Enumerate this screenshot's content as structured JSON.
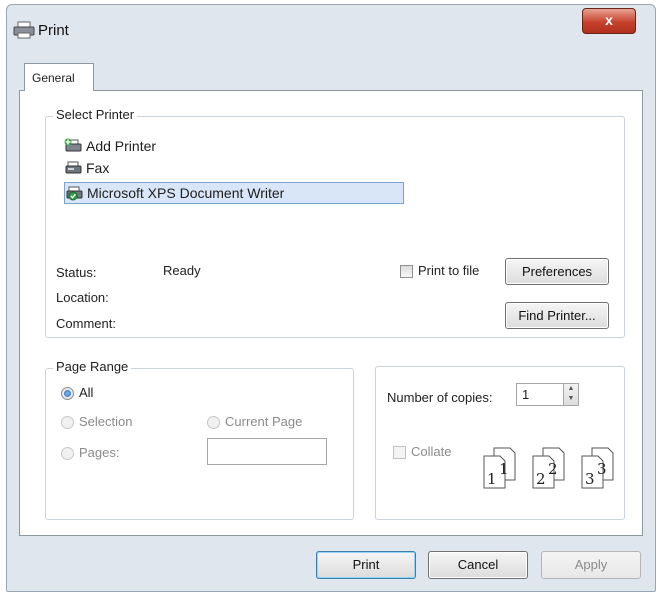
{
  "window": {
    "title": "Print",
    "close_glyph": "x"
  },
  "tabs": [
    {
      "label": "General"
    }
  ],
  "select_printer": {
    "legend": "Select Printer",
    "printers": [
      {
        "label": "Add Printer",
        "icon": "add-printer-icon"
      },
      {
        "label": "Fax",
        "icon": "fax-printer-icon"
      },
      {
        "label": "Microsoft XPS Document Writer",
        "icon": "xps-printer-icon",
        "selected": true
      }
    ],
    "status_label": "Status:",
    "status_value": "Ready",
    "location_label": "Location:",
    "location_value": "",
    "comment_label": "Comment:",
    "comment_value": "",
    "print_to_file_label": "Print to file",
    "print_to_file_checked": false,
    "preferences_label": "Preferences",
    "find_printer_label": "Find Printer..."
  },
  "page_range": {
    "legend": "Page Range",
    "options": [
      {
        "label": "All",
        "checked": true
      },
      {
        "label": "Selection",
        "checked": false,
        "enabled": false
      },
      {
        "label": "Current Page",
        "checked": false,
        "enabled": false
      },
      {
        "label": "Pages:",
        "checked": false,
        "enabled": false
      }
    ],
    "pages_value": ""
  },
  "copies": {
    "number_label": "Number of copies:",
    "value": "1",
    "collate_label": "Collate",
    "collate_checked": false,
    "collate_digits": [
      "1",
      "1",
      "2",
      "2",
      "3",
      "3"
    ]
  },
  "footer": {
    "print_label": "Print",
    "cancel_label": "Cancel",
    "apply_label": "Apply"
  },
  "colors": {
    "window_bg": "#dfe6ee",
    "selection_bg": "#d8e6f8",
    "close_red": "#c6412d"
  }
}
